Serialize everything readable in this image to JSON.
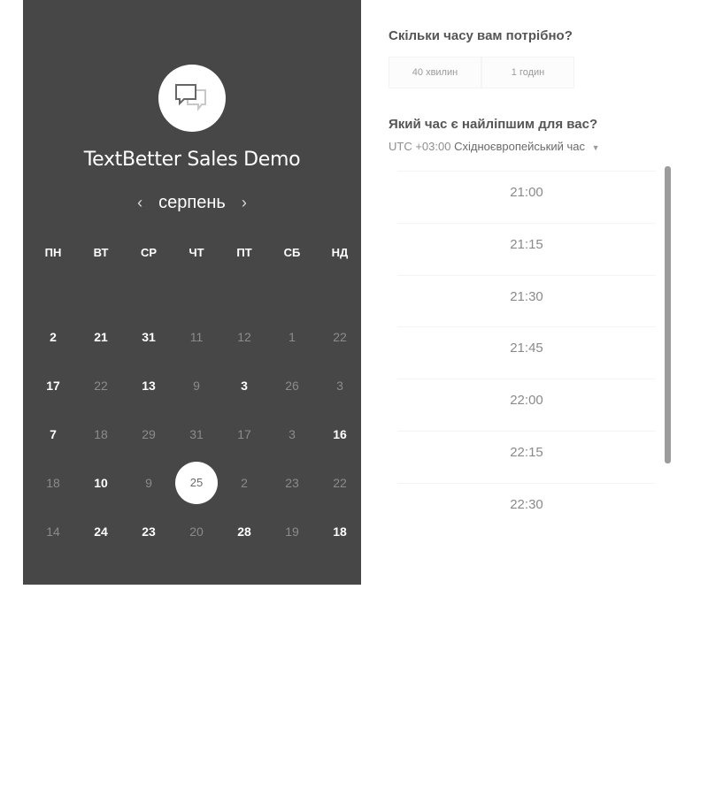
{
  "calendar": {
    "title": "TextBetter Sales Demo",
    "logo_icon": "chat-bubbles-icon",
    "month": "серпень",
    "prev_icon": "‹",
    "next_icon": "›",
    "weekdays": [
      "ПН",
      "ВТ",
      "СР",
      "ЧТ",
      "ПТ",
      "СБ",
      "НД"
    ],
    "rows": [
      [
        {
          "d": "2",
          "s": "active"
        },
        {
          "d": "21",
          "s": "active"
        },
        {
          "d": "31",
          "s": "active"
        },
        {
          "d": "11",
          "s": "dim"
        },
        {
          "d": "12",
          "s": "dim"
        },
        {
          "d": "1",
          "s": "dim"
        },
        {
          "d": "22",
          "s": "dim"
        }
      ],
      [
        {
          "d": "17",
          "s": "active"
        },
        {
          "d": "22",
          "s": "dim"
        },
        {
          "d": "13",
          "s": "active"
        },
        {
          "d": "9",
          "s": "dim"
        },
        {
          "d": "3",
          "s": "active"
        },
        {
          "d": "26",
          "s": "dim"
        },
        {
          "d": "3",
          "s": "dim"
        }
      ],
      [
        {
          "d": "7",
          "s": "active"
        },
        {
          "d": "18",
          "s": "dim"
        },
        {
          "d": "29",
          "s": "dim"
        },
        {
          "d": "31",
          "s": "dim"
        },
        {
          "d": "17",
          "s": "dim"
        },
        {
          "d": "3",
          "s": "dim"
        },
        {
          "d": "16",
          "s": "active"
        }
      ],
      [
        {
          "d": "18",
          "s": "dim"
        },
        {
          "d": "10",
          "s": "active"
        },
        {
          "d": "9",
          "s": "dim"
        },
        {
          "d": "25",
          "s": "selected"
        },
        {
          "d": "2",
          "s": "dim"
        },
        {
          "d": "23",
          "s": "dim"
        },
        {
          "d": "22",
          "s": "dim"
        }
      ],
      [
        {
          "d": "14",
          "s": "dim"
        },
        {
          "d": "24",
          "s": "active"
        },
        {
          "d": "23",
          "s": "active"
        },
        {
          "d": "20",
          "s": "dim"
        },
        {
          "d": "28",
          "s": "active"
        },
        {
          "d": "19",
          "s": "dim"
        },
        {
          "d": "18",
          "s": "active"
        }
      ]
    ]
  },
  "duration": {
    "question": "Скільки часу вам потрібно?",
    "options": [
      "40 хвилин",
      "1 годин"
    ]
  },
  "time": {
    "question": "Який час є найліпшим для вас?",
    "timezone_offset": "UTC +03:00",
    "timezone_name": "Східноєвропейський час",
    "slots": [
      "21:00",
      "21:15",
      "21:30",
      "21:45",
      "22:00",
      "22:15",
      "22:30"
    ]
  },
  "colors": {
    "panel": "#474747",
    "active_day": "#ffffff",
    "dim_day": "#8b8b8b"
  }
}
